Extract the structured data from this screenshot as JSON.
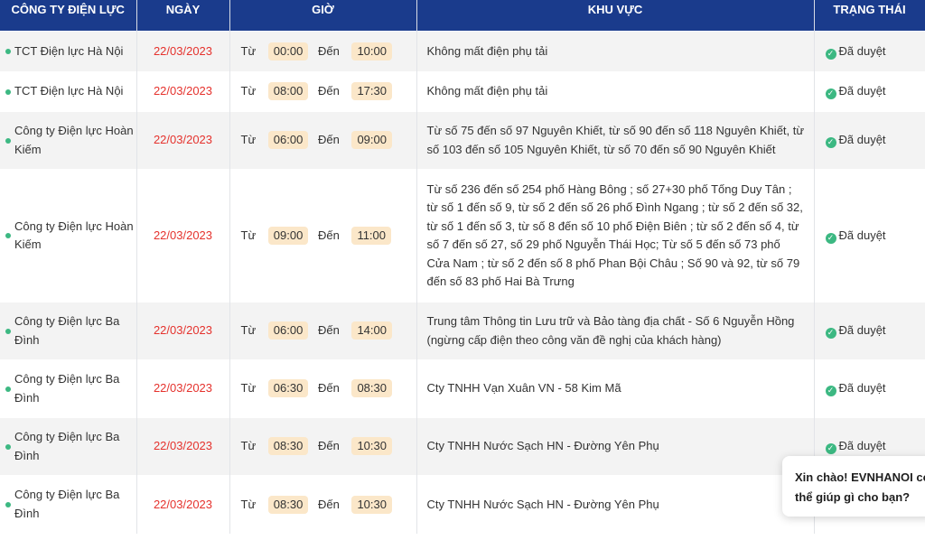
{
  "headers": [
    "CÔNG TY ĐIỆN LỰC",
    "NGÀY",
    "GIỜ",
    "KHU VỰC",
    "TRẠNG THÁI"
  ],
  "labels": {
    "from": "Từ",
    "to": "Đến"
  },
  "rows": [
    {
      "company": "TCT Điện lực Hà Nội",
      "date": "22/03/2023",
      "start": "00:00",
      "end": "10:00",
      "area": "Không mất điện phụ tải",
      "status": "Đã duyệt"
    },
    {
      "company": "TCT Điện lực Hà Nội",
      "date": "22/03/2023",
      "start": "08:00",
      "end": "17:30",
      "area": "Không mất điện phụ tải",
      "status": "Đã duyệt"
    },
    {
      "company": "Công ty Điện lực Hoàn Kiếm",
      "date": "22/03/2023",
      "start": "06:00",
      "end": "09:00",
      "area": "Từ số 75 đến số 97 Nguyên Khiết, từ số 90 đến số 118 Nguyên Khiết, từ số 103 đến số 105 Nguyên Khiết, từ số 70 đến số 90 Nguyên Khiết",
      "status": "Đã duyệt"
    },
    {
      "company": "Công ty Điện lực Hoàn Kiếm",
      "date": "22/03/2023",
      "start": "09:00",
      "end": "11:00",
      "area": "Từ số 236 đến số 254 phố Hàng Bông ; số 27+30 phố Tống Duy Tân ; từ số 1 đến số 9, từ số 2 đến số 26 phố Đình Ngang ; từ số 2 đến số 32, từ số 1 đến số 3, từ số 8 đến số 10 phố Điện Biên ; từ số 2 đến số 4, từ số 7 đến số 27, số 29 phố Nguyễn Thái Học; Từ số 5 đến số 73 phố Cửa Nam ; từ số 2 đến số 8 phố Phan Bội Châu ; Số 90 và 92, từ số 79 đến số 83 phố Hai Bà Trưng",
      "status": "Đã duyệt"
    },
    {
      "company": "Công ty Điện lực Ba Đình",
      "date": "22/03/2023",
      "start": "06:00",
      "end": "14:00",
      "area": "Trung tâm Thông tin Lưu trữ và Bảo tàng địa chất - Số 6 Nguyễn Hồng (ngừng cấp điện theo công văn đề nghị của khách hàng)",
      "status": "Đã duyệt"
    },
    {
      "company": "Công ty Điện lực Ba Đình",
      "date": "22/03/2023",
      "start": "06:30",
      "end": "08:30",
      "area": "Cty TNHH Vạn Xuân VN - 58 Kim Mã",
      "status": "Đã duyệt"
    },
    {
      "company": "Công ty Điện lực Ba Đình",
      "date": "22/03/2023",
      "start": "08:30",
      "end": "10:30",
      "area": "Cty TNHH Nước Sạch HN - Đường Yên Phụ",
      "status": "Đã duyệt"
    },
    {
      "company": "Công ty Điện lực Ba Đình",
      "date": "22/03/2023",
      "start": "08:30",
      "end": "10:30",
      "area": "Cty TNHH Nước Sạch HN - Đường Yên Phụ",
      "status": ""
    }
  ],
  "chat": {
    "line1": "Xin chào! EVNHANOI có",
    "line2": "thể giúp gì cho bạn?"
  }
}
